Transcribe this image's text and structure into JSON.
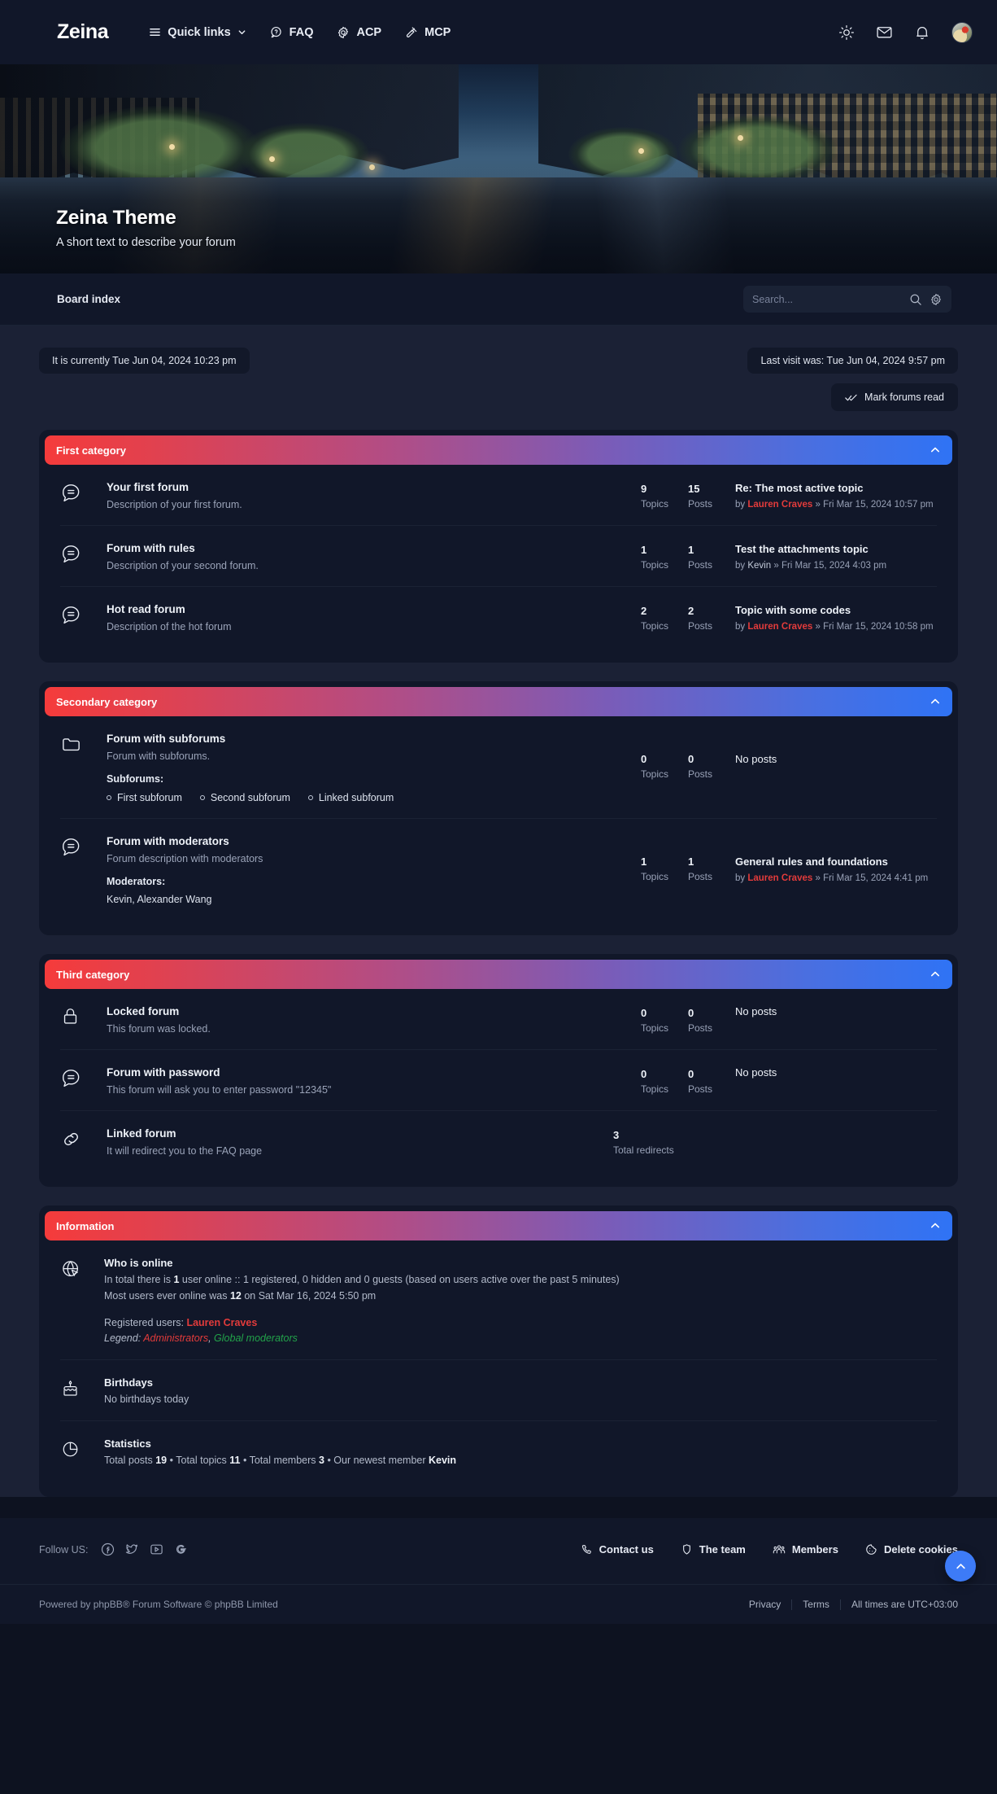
{
  "header": {
    "brand": "Zeina",
    "nav": [
      {
        "label": "Quick links",
        "icon": "hamburger-icon",
        "caret": true
      },
      {
        "label": "FAQ",
        "icon": "question-bubble-icon",
        "caret": false
      },
      {
        "label": "ACP",
        "icon": "gear-icon",
        "caret": false
      },
      {
        "label": "MCP",
        "icon": "gavel-icon",
        "caret": false
      }
    ],
    "actions": [
      {
        "name": "theme-toggle",
        "icon": "sun-icon"
      },
      {
        "name": "private-messages",
        "icon": "envelope-icon"
      },
      {
        "name": "notifications",
        "icon": "bell-icon"
      },
      {
        "name": "user-avatar",
        "icon": "avatar"
      }
    ]
  },
  "hero": {
    "title": "Zeina Theme",
    "subtitle": "A short text to describe your forum"
  },
  "crumbbar": {
    "breadcrumb": "Board index",
    "search_placeholder": "Search...",
    "search_value": "",
    "search_icon": "magnifier-icon",
    "settings_icon": "gear-icon"
  },
  "status": {
    "current_time": "It is currently Tue Jun 04, 2024 10:23 pm",
    "last_visit": "Last visit was: Tue Jun 04, 2024 9:57 pm",
    "mark_read": "Mark forums read",
    "mark_read_icon": "double-check-icon"
  },
  "categories": [
    {
      "title": "First category",
      "collapse_icon": "chevron-up-icon",
      "forums": [
        {
          "icon": "speech-bubble-icon",
          "name": "Your first forum",
          "desc": "Description of your first forum.",
          "topics": "9",
          "topics_label": "Topics",
          "posts": "15",
          "posts_label": "Posts",
          "last_title": "Re: The most active topic",
          "last_by": "by",
          "last_user": "Lauren Craves",
          "user_style": "admin",
          "last_sep": "»",
          "last_date": "Fri Mar 15, 2024 10:57 pm"
        },
        {
          "icon": "speech-bubble-icon",
          "name": "Forum with rules",
          "desc": "Description of your second forum.",
          "topics": "1",
          "topics_label": "Topics",
          "posts": "1",
          "posts_label": "Posts",
          "last_title": "Test the attachments topic",
          "last_by": "by",
          "last_user": "Kevin",
          "user_style": "plain",
          "last_sep": "»",
          "last_date": "Fri Mar 15, 2024 4:03 pm"
        },
        {
          "icon": "speech-bubble-icon",
          "name": "Hot read forum",
          "desc": "Description of the hot forum",
          "topics": "2",
          "topics_label": "Topics",
          "posts": "2",
          "posts_label": "Posts",
          "last_title": "Topic with some codes",
          "last_by": "by",
          "last_user": "Lauren Craves",
          "user_style": "admin",
          "last_sep": "»",
          "last_date": "Fri Mar 15, 2024 10:58 pm"
        }
      ]
    },
    {
      "title": "Secondary category",
      "collapse_icon": "chevron-up-icon",
      "forums": [
        {
          "icon": "folder-icon",
          "name": "Forum with subforums",
          "desc": "Forum with subforums.",
          "subforums_label": "Subforums:",
          "subforums": [
            "First subforum",
            "Second subforum",
            "Linked subforum"
          ],
          "topics": "0",
          "topics_label": "Topics",
          "posts": "0",
          "posts_label": "Posts",
          "last_title": "No posts"
        },
        {
          "icon": "speech-bubble-icon",
          "name": "Forum with moderators",
          "desc": "Forum description with moderators",
          "moderators_label": "Moderators:",
          "moderators": "Kevin,  Alexander Wang",
          "topics": "1",
          "topics_label": "Topics",
          "posts": "1",
          "posts_label": "Posts",
          "last_title": "General rules and foundations",
          "last_by": "by",
          "last_user": "Lauren Craves",
          "user_style": "admin",
          "last_sep": "»",
          "last_date": "Fri Mar 15, 2024 4:41 pm"
        }
      ]
    },
    {
      "title": "Third category",
      "collapse_icon": "chevron-up-icon",
      "forums": [
        {
          "icon": "lock-icon",
          "name": "Locked forum",
          "desc": "This forum was locked.",
          "topics": "0",
          "topics_label": "Topics",
          "posts": "0",
          "posts_label": "Posts",
          "last_title": "No posts"
        },
        {
          "icon": "speech-bubble-icon",
          "name": "Forum with password",
          "desc": "This forum will ask you to enter password \"12345\"",
          "topics": "0",
          "topics_label": "Topics",
          "posts": "0",
          "posts_label": "Posts",
          "last_title": "No posts"
        },
        {
          "icon": "link-icon",
          "name": "Linked forum",
          "desc": "It will redirect you to the FAQ page",
          "redirects": "3",
          "redirects_label": "Total redirects"
        }
      ]
    }
  ],
  "information": {
    "title": "Information",
    "collapse_icon": "chevron-up-icon",
    "who_online": {
      "icon": "globe-cursor-icon",
      "title": "Who is online",
      "line1_a": "In total there is ",
      "line1_b": "1",
      "line1_c": " user online :: 1 registered, 0 hidden and 0 guests (based on users active over the past 5 minutes)",
      "line2_a": "Most users ever online was ",
      "line2_b": "12",
      "line2_c": " on Sat Mar 16, 2024 5:50 pm",
      "registered_label": "Registered users: ",
      "registered_users": "Lauren Craves",
      "legend_label": "Legend: ",
      "legend_admins": "Administrators",
      "legend_comma": ", ",
      "legend_gmods": "Global moderators"
    },
    "birthdays": {
      "icon": "cake-icon",
      "title": "Birthdays",
      "text": "No birthdays today"
    },
    "statistics": {
      "icon": "pie-chart-icon",
      "title": "Statistics",
      "a": "Total posts ",
      "posts": "19",
      "b": " • Total topics ",
      "topics": "11",
      "c": " • Total members ",
      "members": "3",
      "d": " • Our newest member ",
      "newest": "Kevin"
    }
  },
  "footer": {
    "follow_label": "Follow US:",
    "social": [
      {
        "name": "facebook-icon"
      },
      {
        "name": "twitter-icon"
      },
      {
        "name": "youtube-icon"
      },
      {
        "name": "google-icon"
      }
    ],
    "links": [
      {
        "label": "Contact us",
        "icon": "phone-icon"
      },
      {
        "label": "The team",
        "icon": "shield-icon"
      },
      {
        "label": "Members",
        "icon": "people-icon"
      },
      {
        "label": "Delete cookies",
        "icon": "cookie-icon"
      }
    ],
    "copyright": "Powered by phpBB® Forum Software © phpBB Limited",
    "privacy": "Privacy",
    "terms": "Terms",
    "timezone": "All times are UTC+03:00",
    "to_top_icon": "chevron-up-icon"
  },
  "colors": {
    "accent_start": "#f53b3b",
    "accent_end": "#2f73f5",
    "link_red": "#e23b3b",
    "link_green": "#22a34a",
    "page_bg": "#1b2135",
    "panel_bg": "#111729"
  }
}
